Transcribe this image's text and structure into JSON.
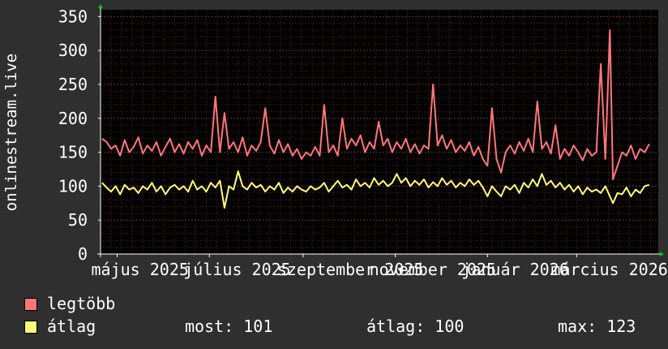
{
  "chart_data": {
    "type": "line",
    "ylabel": "onlinestream.live",
    "ylim": [
      0,
      360
    ],
    "yticks": [
      0,
      50,
      100,
      150,
      200,
      250,
      300,
      350
    ],
    "xlim": [
      "2025-04-20",
      "2026-04-24"
    ],
    "xticks": [
      {
        "label": "május 2025",
        "date": "2025-05-01"
      },
      {
        "label": "július 2025",
        "date": "2025-07-01"
      },
      {
        "label": "szeptember 2025",
        "date": "2025-09-01"
      },
      {
        "label": "november 2025",
        "date": "2025-11-01"
      },
      {
        "label": "január 2026",
        "date": "2026-01-01"
      },
      {
        "label": "március 2026",
        "date": "2026-03-01"
      }
    ],
    "grid": true,
    "series": [
      {
        "name": "legtöbb",
        "color": "#ff7777",
        "points": [
          [
            "2025-04-21",
            170
          ],
          [
            "2025-04-24",
            165
          ],
          [
            "2025-04-27",
            155
          ],
          [
            "2025-04-30",
            160
          ],
          [
            "2025-05-03",
            145
          ],
          [
            "2025-05-06",
            168
          ],
          [
            "2025-05-09",
            150
          ],
          [
            "2025-05-12",
            158
          ],
          [
            "2025-05-15",
            172
          ],
          [
            "2025-05-18",
            148
          ],
          [
            "2025-05-21",
            160
          ],
          [
            "2025-05-24",
            152
          ],
          [
            "2025-05-27",
            165
          ],
          [
            "2025-05-30",
            145
          ],
          [
            "2025-06-02",
            158
          ],
          [
            "2025-06-05",
            170
          ],
          [
            "2025-06-08",
            150
          ],
          [
            "2025-06-11",
            162
          ],
          [
            "2025-06-14",
            148
          ],
          [
            "2025-06-17",
            165
          ],
          [
            "2025-06-20",
            155
          ],
          [
            "2025-06-23",
            168
          ],
          [
            "2025-06-26",
            145
          ],
          [
            "2025-06-29",
            160
          ],
          [
            "2025-07-02",
            150
          ],
          [
            "2025-07-05",
            232
          ],
          [
            "2025-07-08",
            150
          ],
          [
            "2025-07-11",
            208
          ],
          [
            "2025-07-14",
            155
          ],
          [
            "2025-07-17",
            165
          ],
          [
            "2025-07-20",
            150
          ],
          [
            "2025-07-23",
            172
          ],
          [
            "2025-07-26",
            145
          ],
          [
            "2025-07-29",
            160
          ],
          [
            "2025-08-01",
            152
          ],
          [
            "2025-08-04",
            165
          ],
          [
            "2025-08-07",
            215
          ],
          [
            "2025-08-10",
            160
          ],
          [
            "2025-08-13",
            148
          ],
          [
            "2025-08-16",
            168
          ],
          [
            "2025-08-19",
            150
          ],
          [
            "2025-08-22",
            162
          ],
          [
            "2025-08-25",
            145
          ],
          [
            "2025-08-28",
            155
          ],
          [
            "2025-08-31",
            140
          ],
          [
            "2025-09-03",
            150
          ],
          [
            "2025-09-06",
            145
          ],
          [
            "2025-09-09",
            158
          ],
          [
            "2025-09-12",
            145
          ],
          [
            "2025-09-15",
            220
          ],
          [
            "2025-09-18",
            150
          ],
          [
            "2025-09-21",
            160
          ],
          [
            "2025-09-24",
            145
          ],
          [
            "2025-09-27",
            200
          ],
          [
            "2025-09-30",
            155
          ],
          [
            "2025-10-03",
            170
          ],
          [
            "2025-10-06",
            160
          ],
          [
            "2025-10-09",
            175
          ],
          [
            "2025-10-12",
            150
          ],
          [
            "2025-10-15",
            165
          ],
          [
            "2025-10-18",
            155
          ],
          [
            "2025-10-21",
            195
          ],
          [
            "2025-10-24",
            160
          ],
          [
            "2025-10-27",
            170
          ],
          [
            "2025-10-30",
            150
          ],
          [
            "2025-11-02",
            165
          ],
          [
            "2025-11-05",
            155
          ],
          [
            "2025-11-08",
            170
          ],
          [
            "2025-11-11",
            150
          ],
          [
            "2025-11-14",
            162
          ],
          [
            "2025-11-17",
            148
          ],
          [
            "2025-11-20",
            160
          ],
          [
            "2025-11-23",
            155
          ],
          [
            "2025-11-26",
            250
          ],
          [
            "2025-11-29",
            160
          ],
          [
            "2025-12-02",
            175
          ],
          [
            "2025-12-05",
            155
          ],
          [
            "2025-12-08",
            168
          ],
          [
            "2025-12-11",
            150
          ],
          [
            "2025-12-14",
            160
          ],
          [
            "2025-12-17",
            152
          ],
          [
            "2025-12-20",
            165
          ],
          [
            "2025-12-23",
            145
          ],
          [
            "2025-12-26",
            158
          ],
          [
            "2025-12-29",
            140
          ],
          [
            "2026-01-01",
            130
          ],
          [
            "2026-01-04",
            215
          ],
          [
            "2026-01-07",
            140
          ],
          [
            "2026-01-10",
            120
          ],
          [
            "2026-01-13",
            150
          ],
          [
            "2026-01-16",
            160
          ],
          [
            "2026-01-19",
            148
          ],
          [
            "2026-01-22",
            165
          ],
          [
            "2026-01-25",
            152
          ],
          [
            "2026-01-28",
            170
          ],
          [
            "2026-01-31",
            150
          ],
          [
            "2026-02-03",
            225
          ],
          [
            "2026-02-06",
            155
          ],
          [
            "2026-02-09",
            165
          ],
          [
            "2026-02-12",
            148
          ],
          [
            "2026-02-15",
            190
          ],
          [
            "2026-02-18",
            140
          ],
          [
            "2026-02-21",
            155
          ],
          [
            "2026-02-24",
            145
          ],
          [
            "2026-02-27",
            160
          ],
          [
            "2026-03-02",
            150
          ],
          [
            "2026-03-05",
            138
          ],
          [
            "2026-03-08",
            155
          ],
          [
            "2026-03-11",
            145
          ],
          [
            "2026-03-14",
            150
          ],
          [
            "2026-03-17",
            280
          ],
          [
            "2026-03-20",
            140
          ],
          [
            "2026-03-23",
            330
          ],
          [
            "2026-03-25",
            110
          ],
          [
            "2026-03-28",
            130
          ],
          [
            "2026-03-31",
            150
          ],
          [
            "2026-04-03",
            145
          ],
          [
            "2026-04-06",
            160
          ],
          [
            "2026-04-09",
            140
          ],
          [
            "2026-04-12",
            155
          ],
          [
            "2026-04-15",
            150
          ],
          [
            "2026-04-18",
            162
          ]
        ]
      },
      {
        "name": "átlag",
        "color": "#ffff77",
        "points": [
          [
            "2025-04-21",
            105
          ],
          [
            "2025-04-24",
            98
          ],
          [
            "2025-04-27",
            92
          ],
          [
            "2025-04-30",
            100
          ],
          [
            "2025-05-03",
            88
          ],
          [
            "2025-05-06",
            102
          ],
          [
            "2025-05-09",
            95
          ],
          [
            "2025-05-12",
            98
          ],
          [
            "2025-05-15",
            90
          ],
          [
            "2025-05-18",
            100
          ],
          [
            "2025-05-21",
            95
          ],
          [
            "2025-05-24",
            105
          ],
          [
            "2025-05-27",
            92
          ],
          [
            "2025-05-30",
            100
          ],
          [
            "2025-06-02",
            88
          ],
          [
            "2025-06-05",
            98
          ],
          [
            "2025-06-08",
            102
          ],
          [
            "2025-06-11",
            95
          ],
          [
            "2025-06-14",
            100
          ],
          [
            "2025-06-17",
            92
          ],
          [
            "2025-06-20",
            108
          ],
          [
            "2025-06-23",
            95
          ],
          [
            "2025-06-26",
            100
          ],
          [
            "2025-06-29",
            92
          ],
          [
            "2025-07-02",
            105
          ],
          [
            "2025-07-05",
            98
          ],
          [
            "2025-07-08",
            108
          ],
          [
            "2025-07-11",
            68
          ],
          [
            "2025-07-14",
            100
          ],
          [
            "2025-07-17",
            95
          ],
          [
            "2025-07-20",
            122
          ],
          [
            "2025-07-23",
            100
          ],
          [
            "2025-07-26",
            95
          ],
          [
            "2025-07-29",
            105
          ],
          [
            "2025-08-01",
            98
          ],
          [
            "2025-08-04",
            102
          ],
          [
            "2025-08-07",
            92
          ],
          [
            "2025-08-10",
            100
          ],
          [
            "2025-08-13",
            95
          ],
          [
            "2025-08-16",
            105
          ],
          [
            "2025-08-19",
            90
          ],
          [
            "2025-08-22",
            98
          ],
          [
            "2025-08-25",
            92
          ],
          [
            "2025-08-28",
            100
          ],
          [
            "2025-08-31",
            95
          ],
          [
            "2025-09-03",
            92
          ],
          [
            "2025-09-06",
            100
          ],
          [
            "2025-09-09",
            95
          ],
          [
            "2025-09-12",
            98
          ],
          [
            "2025-09-15",
            105
          ],
          [
            "2025-09-18",
            92
          ],
          [
            "2025-09-21",
            100
          ],
          [
            "2025-09-24",
            108
          ],
          [
            "2025-09-27",
            98
          ],
          [
            "2025-09-30",
            102
          ],
          [
            "2025-10-03",
            95
          ],
          [
            "2025-10-06",
            110
          ],
          [
            "2025-10-09",
            100
          ],
          [
            "2025-10-12",
            105
          ],
          [
            "2025-10-15",
            98
          ],
          [
            "2025-10-18",
            112
          ],
          [
            "2025-10-21",
            102
          ],
          [
            "2025-10-24",
            108
          ],
          [
            "2025-10-27",
            100
          ],
          [
            "2025-10-30",
            105
          ],
          [
            "2025-11-02",
            118
          ],
          [
            "2025-11-05",
            105
          ],
          [
            "2025-11-08",
            112
          ],
          [
            "2025-11-11",
            100
          ],
          [
            "2025-11-14",
            108
          ],
          [
            "2025-11-17",
            102
          ],
          [
            "2025-11-20",
            110
          ],
          [
            "2025-11-23",
            98
          ],
          [
            "2025-11-26",
            106
          ],
          [
            "2025-11-29",
            100
          ],
          [
            "2025-12-02",
            112
          ],
          [
            "2025-12-05",
            102
          ],
          [
            "2025-12-08",
            108
          ],
          [
            "2025-12-11",
            98
          ],
          [
            "2025-12-14",
            105
          ],
          [
            "2025-12-17",
            100
          ],
          [
            "2025-12-20",
            110
          ],
          [
            "2025-12-23",
            102
          ],
          [
            "2025-12-26",
            108
          ],
          [
            "2025-12-29",
            98
          ],
          [
            "2026-01-01",
            85
          ],
          [
            "2026-01-04",
            100
          ],
          [
            "2026-01-07",
            92
          ],
          [
            "2026-01-10",
            85
          ],
          [
            "2026-01-13",
            100
          ],
          [
            "2026-01-16",
            95
          ],
          [
            "2026-01-19",
            102
          ],
          [
            "2026-01-22",
            90
          ],
          [
            "2026-01-25",
            105
          ],
          [
            "2026-01-28",
            98
          ],
          [
            "2026-01-31",
            110
          ],
          [
            "2026-02-03",
            100
          ],
          [
            "2026-02-06",
            118
          ],
          [
            "2026-02-09",
            102
          ],
          [
            "2026-02-12",
            108
          ],
          [
            "2026-02-15",
            98
          ],
          [
            "2026-02-18",
            105
          ],
          [
            "2026-02-21",
            95
          ],
          [
            "2026-02-24",
            102
          ],
          [
            "2026-02-27",
            92
          ],
          [
            "2026-03-02",
            100
          ],
          [
            "2026-03-05",
            88
          ],
          [
            "2026-03-08",
            98
          ],
          [
            "2026-03-11",
            92
          ],
          [
            "2026-03-14",
            95
          ],
          [
            "2026-03-17",
            90
          ],
          [
            "2026-03-20",
            100
          ],
          [
            "2026-03-23",
            85
          ],
          [
            "2026-03-25",
            75
          ],
          [
            "2026-03-28",
            90
          ],
          [
            "2026-03-31",
            88
          ],
          [
            "2026-04-03",
            98
          ],
          [
            "2026-04-06",
            85
          ],
          [
            "2026-04-09",
            95
          ],
          [
            "2026-04-12",
            90
          ],
          [
            "2026-04-15",
            100
          ],
          [
            "2026-04-18",
            102
          ]
        ]
      }
    ]
  },
  "legend": {
    "max_label": "legtöbb",
    "avg_label": "átlag",
    "stats": [
      {
        "label": "most:",
        "value": "101"
      },
      {
        "label": "átlag:",
        "value": "100"
      },
      {
        "label": "max:",
        "value": "123"
      }
    ]
  },
  "colors": {
    "background": "#2f2f2f",
    "plot_background": "#000000",
    "grid": "#5a2020",
    "axis": "#ffffff",
    "arrow": "#00cc00"
  }
}
